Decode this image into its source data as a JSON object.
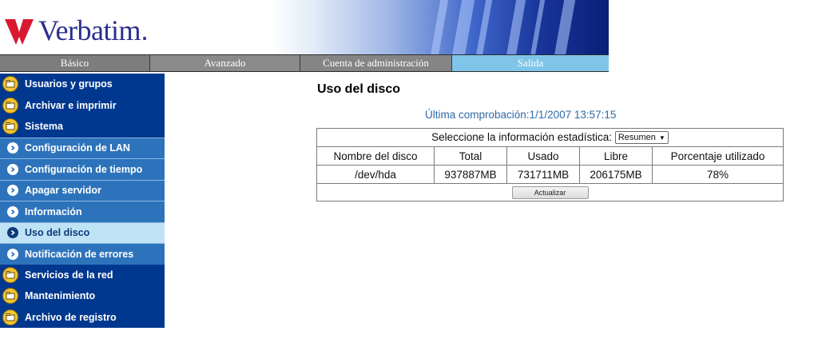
{
  "brand": {
    "name": "Verbatim",
    "dot": ".",
    "colors": {
      "logo": "#2a2e8f",
      "mark": "#d8192f"
    }
  },
  "topnav": {
    "tabs": [
      {
        "label": "Básico"
      },
      {
        "label": "Avanzado"
      },
      {
        "label": "Cuenta de administración"
      },
      {
        "label": "Salida"
      }
    ]
  },
  "sidebar": {
    "items": [
      {
        "label": "Usuarios y grupos",
        "icon": "folder-icon"
      },
      {
        "label": "Archivar e imprimir",
        "icon": "folder-icon"
      },
      {
        "label": "Sistema",
        "icon": "folder-icon"
      },
      {
        "label": "Configuración de LAN",
        "icon": "arrow-right-icon"
      },
      {
        "label": "Configuración de tiempo",
        "icon": "arrow-right-icon"
      },
      {
        "label": "Apagar servidor",
        "icon": "arrow-right-icon"
      },
      {
        "label": "Información",
        "icon": "arrow-right-icon"
      },
      {
        "label": "Uso del disco",
        "icon": "arrow-right-icon",
        "active": true
      },
      {
        "label": "Notificación de errores",
        "icon": "arrow-right-icon"
      },
      {
        "label": "Servicios de la red",
        "icon": "folder-icon"
      },
      {
        "label": "Mantenimiento",
        "icon": "folder-icon"
      },
      {
        "label": "Archivo de registro",
        "icon": "folder-icon"
      }
    ]
  },
  "main": {
    "title": "Uso del disco",
    "last_check": "Última comprobación:1/1/2007 13:57:15",
    "stat_prompt": "Seleccione la información estadística:",
    "stat_select_value": "Resumen",
    "columns": [
      "Nombre del disco",
      "Total",
      "Usado",
      "Libre",
      "Porcentaje utilizado"
    ],
    "rows": [
      [
        "/dev/hda",
        "937887MB",
        "731711MB",
        "206175MB",
        "78%"
      ]
    ],
    "refresh_label": "Actualizar"
  }
}
